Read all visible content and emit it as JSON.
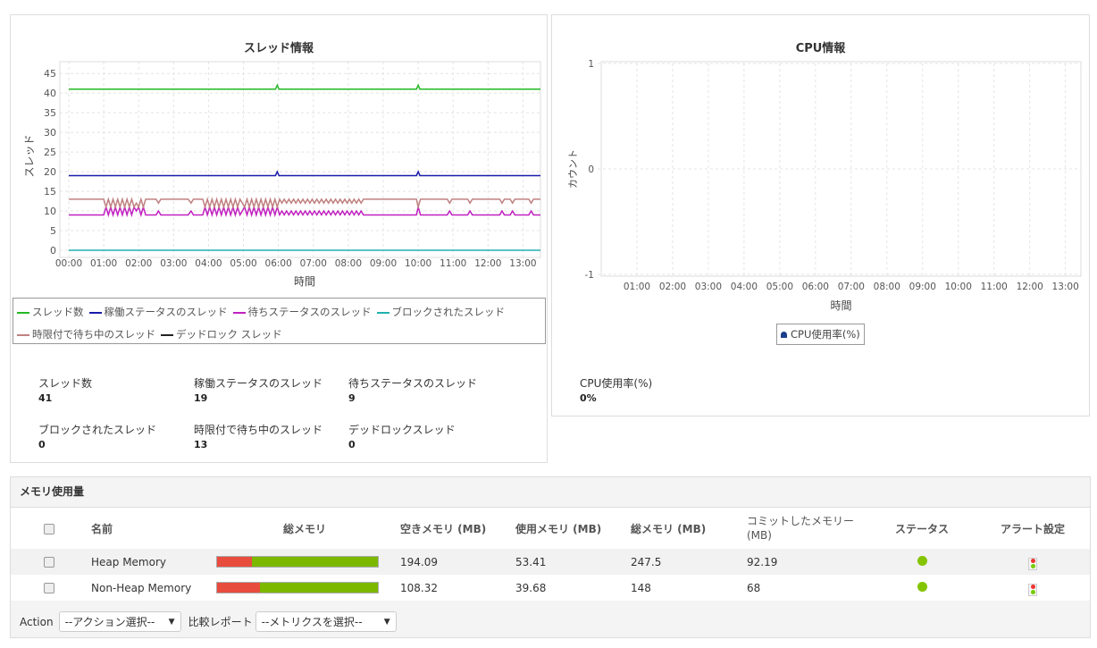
{
  "threads": {
    "title": "スレッド情報",
    "ylabel": "スレッド",
    "xlabel": "時間",
    "stats": [
      {
        "label": "スレッド数",
        "value": "41"
      },
      {
        "label": "稼働ステータスのスレッド",
        "value": "19"
      },
      {
        "label": "待ちステータスのスレッド",
        "value": "9"
      },
      {
        "label": "ブロックされたスレッド",
        "value": "0"
      },
      {
        "label": "時限付で待ち中のスレッド",
        "value": "13"
      },
      {
        "label": "デッドロックスレッド",
        "value": "0"
      }
    ]
  },
  "cpu": {
    "title": "CPU情報",
    "ylabel": "カウント",
    "xlabel": "時間",
    "legend": "CPU使用率(%)",
    "stat_label": "CPU使用率(%)",
    "stat_value": "0%"
  },
  "chart_data": [
    {
      "type": "line",
      "title": "スレッド情報",
      "xlabel": "時間",
      "ylabel": "スレッド",
      "x_unit": "minutes",
      "xlim": [
        0,
        810
      ],
      "ylim": [
        0,
        48
      ],
      "yticks": [
        0,
        5,
        10,
        15,
        20,
        25,
        30,
        35,
        40,
        45
      ],
      "xticks": [
        "00:00",
        "01:00",
        "02:00",
        "03:00",
        "04:00",
        "05:00",
        "06:00",
        "07:00",
        "08:00",
        "09:00",
        "10:00",
        "11:00",
        "12:00",
        "13:00"
      ],
      "grid": true,
      "legend": "bottom",
      "series": [
        {
          "name": "スレッド数",
          "color": "#22b822",
          "points": [
            [
              0,
              41
            ],
            [
              355,
              41
            ],
            [
              358,
              42
            ],
            [
              361,
              41
            ],
            [
              597,
              41
            ],
            [
              600,
              42
            ],
            [
              603,
              41
            ],
            [
              810,
              41
            ]
          ]
        },
        {
          "name": "稼働ステータスのスレッド",
          "color": "#1a1aaa",
          "points": [
            [
              0,
              19
            ],
            [
              355,
              19
            ],
            [
              358,
              20
            ],
            [
              361,
              19
            ],
            [
              597,
              19
            ],
            [
              600,
              20
            ],
            [
              603,
              19
            ],
            [
              810,
              19
            ]
          ]
        },
        {
          "name": "待ちステータスのスレッド",
          "color": "#c020c0",
          "points": [
            [
              0,
              9
            ],
            [
              60,
              9
            ],
            [
              64,
              11
            ],
            [
              68,
              9
            ],
            [
              72,
              11
            ],
            [
              76,
              9
            ],
            [
              80,
              11
            ],
            [
              84,
              9
            ],
            [
              88,
              11
            ],
            [
              92,
              9
            ],
            [
              96,
              11
            ],
            [
              100,
              9
            ],
            [
              104,
              11
            ],
            [
              108,
              9
            ],
            [
              112,
              11
            ],
            [
              116,
              10
            ],
            [
              120,
              11
            ],
            [
              124,
              9
            ],
            [
              128,
              11
            ],
            [
              132,
              9
            ],
            [
              150,
              9
            ],
            [
              154,
              10
            ],
            [
              158,
              9
            ],
            [
              205,
              9
            ],
            [
              210,
              10
            ],
            [
              214,
              9
            ],
            [
              230,
              9
            ],
            [
              234,
              11
            ],
            [
              238,
              9
            ],
            [
              242,
              11
            ],
            [
              246,
              9
            ],
            [
              250,
              11
            ],
            [
              254,
              9
            ],
            [
              258,
              11
            ],
            [
              262,
              9
            ],
            [
              266,
              11
            ],
            [
              270,
              9
            ],
            [
              274,
              11
            ],
            [
              278,
              9
            ],
            [
              282,
              11
            ],
            [
              286,
              9
            ],
            [
              290,
              11
            ],
            [
              294,
              9
            ],
            [
              298,
              10
            ],
            [
              302,
              11
            ],
            [
              306,
              9
            ],
            [
              310,
              11
            ],
            [
              314,
              9
            ],
            [
              318,
              11
            ],
            [
              322,
              9
            ],
            [
              326,
              11
            ],
            [
              330,
              9
            ],
            [
              334,
              11
            ],
            [
              338,
              9
            ],
            [
              342,
              11
            ],
            [
              346,
              9
            ],
            [
              350,
              11
            ],
            [
              354,
              9
            ],
            [
              358,
              11
            ],
            [
              362,
              9
            ],
            [
              366,
              10
            ],
            [
              370,
              9
            ],
            [
              374,
              10
            ],
            [
              378,
              9
            ],
            [
              382,
              10
            ],
            [
              386,
              9
            ],
            [
              390,
              10
            ],
            [
              394,
              9
            ],
            [
              398,
              10
            ],
            [
              402,
              9
            ],
            [
              406,
              10
            ],
            [
              410,
              9
            ],
            [
              414,
              10
            ],
            [
              418,
              9
            ],
            [
              422,
              10
            ],
            [
              426,
              9
            ],
            [
              430,
              10
            ],
            [
              434,
              9
            ],
            [
              438,
              10
            ],
            [
              442,
              9
            ],
            [
              446,
              10
            ],
            [
              450,
              9
            ],
            [
              454,
              10
            ],
            [
              458,
              9
            ],
            [
              462,
              10
            ],
            [
              466,
              9
            ],
            [
              470,
              10
            ],
            [
              474,
              9
            ],
            [
              478,
              10
            ],
            [
              482,
              9
            ],
            [
              486,
              10
            ],
            [
              490,
              9
            ],
            [
              494,
              10
            ],
            [
              498,
              9
            ],
            [
              502,
              10
            ],
            [
              506,
              9
            ],
            [
              520,
              9
            ],
            [
              597,
              9
            ],
            [
              600,
              11
            ],
            [
              604,
              9
            ],
            [
              650,
              9
            ],
            [
              654,
              10
            ],
            [
              658,
              9
            ],
            [
              685,
              9
            ],
            [
              689,
              10
            ],
            [
              693,
              9
            ],
            [
              740,
              9
            ],
            [
              744,
              10
            ],
            [
              748,
              9
            ],
            [
              758,
              9
            ],
            [
              762,
              10
            ],
            [
              766,
              9
            ],
            [
              790,
              9
            ],
            [
              794,
              10
            ],
            [
              798,
              9
            ],
            [
              810,
              9
            ]
          ]
        },
        {
          "name": "ブロックされたスレッド",
          "color": "#20b0b0",
          "points": [
            [
              0,
              0
            ],
            [
              810,
              0
            ]
          ]
        },
        {
          "name": "時限付で待ち中のスレッド",
          "color": "#c08080",
          "points": [
            [
              0,
              13
            ],
            [
              60,
              13
            ],
            [
              64,
              11
            ],
            [
              68,
              13
            ],
            [
              72,
              11
            ],
            [
              76,
              13
            ],
            [
              80,
              11
            ],
            [
              84,
              13
            ],
            [
              88,
              11
            ],
            [
              92,
              13
            ],
            [
              96,
              11
            ],
            [
              100,
              13
            ],
            [
              104,
              11
            ],
            [
              108,
              13
            ],
            [
              112,
              11
            ],
            [
              116,
              12
            ],
            [
              120,
              11
            ],
            [
              124,
              13
            ],
            [
              128,
              11
            ],
            [
              132,
              13
            ],
            [
              150,
              13
            ],
            [
              154,
              12
            ],
            [
              158,
              13
            ],
            [
              205,
              13
            ],
            [
              210,
              12
            ],
            [
              214,
              13
            ],
            [
              230,
              13
            ],
            [
              234,
              11
            ],
            [
              238,
              13
            ],
            [
              242,
              11
            ],
            [
              246,
              13
            ],
            [
              250,
              11
            ],
            [
              254,
              13
            ],
            [
              258,
              11
            ],
            [
              262,
              13
            ],
            [
              266,
              11
            ],
            [
              270,
              13
            ],
            [
              274,
              11
            ],
            [
              278,
              13
            ],
            [
              282,
              11
            ],
            [
              286,
              13
            ],
            [
              290,
              11
            ],
            [
              294,
              13
            ],
            [
              298,
              12
            ],
            [
              302,
              11
            ],
            [
              306,
              13
            ],
            [
              310,
              11
            ],
            [
              314,
              13
            ],
            [
              318,
              11
            ],
            [
              322,
              13
            ],
            [
              326,
              11
            ],
            [
              330,
              13
            ],
            [
              334,
              11
            ],
            [
              338,
              13
            ],
            [
              342,
              11
            ],
            [
              346,
              13
            ],
            [
              350,
              11
            ],
            [
              354,
              13
            ],
            [
              358,
              11
            ],
            [
              362,
              13
            ],
            [
              366,
              12
            ],
            [
              370,
              13
            ],
            [
              374,
              12
            ],
            [
              378,
              13
            ],
            [
              382,
              12
            ],
            [
              386,
              13
            ],
            [
              390,
              12
            ],
            [
              394,
              13
            ],
            [
              398,
              12
            ],
            [
              402,
              13
            ],
            [
              406,
              12
            ],
            [
              410,
              13
            ],
            [
              414,
              12
            ],
            [
              418,
              13
            ],
            [
              422,
              12
            ],
            [
              426,
              13
            ],
            [
              430,
              12
            ],
            [
              434,
              13
            ],
            [
              438,
              12
            ],
            [
              442,
              13
            ],
            [
              446,
              12
            ],
            [
              450,
              13
            ],
            [
              454,
              12
            ],
            [
              458,
              13
            ],
            [
              462,
              12
            ],
            [
              466,
              13
            ],
            [
              470,
              12
            ],
            [
              474,
              13
            ],
            [
              478,
              12
            ],
            [
              482,
              13
            ],
            [
              486,
              12
            ],
            [
              490,
              13
            ],
            [
              494,
              12
            ],
            [
              498,
              13
            ],
            [
              502,
              12
            ],
            [
              506,
              13
            ],
            [
              520,
              13
            ],
            [
              597,
              13
            ],
            [
              600,
              11
            ],
            [
              604,
              13
            ],
            [
              650,
              13
            ],
            [
              654,
              12
            ],
            [
              658,
              13
            ],
            [
              685,
              13
            ],
            [
              689,
              12
            ],
            [
              693,
              13
            ],
            [
              740,
              13
            ],
            [
              744,
              12
            ],
            [
              748,
              13
            ],
            [
              758,
              13
            ],
            [
              762,
              12
            ],
            [
              766,
              13
            ],
            [
              790,
              13
            ],
            [
              794,
              12
            ],
            [
              798,
              13
            ],
            [
              810,
              13
            ]
          ]
        },
        {
          "name": "デッドロック スレッド",
          "color": "#222222",
          "points": []
        }
      ]
    },
    {
      "type": "line",
      "title": "CPU情報",
      "xlabel": "時間",
      "ylabel": "カウント",
      "x_unit": "minutes",
      "xlim": [
        0,
        806
      ],
      "ylim": [
        -1,
        1
      ],
      "yticks": [
        1,
        0,
        -1
      ],
      "xticks": [
        "01:00",
        "02:00",
        "03:00",
        "04:00",
        "05:00",
        "06:00",
        "07:00",
        "08:00",
        "09:00",
        "10:00",
        "11:00",
        "12:00",
        "13:00"
      ],
      "grid": true,
      "legend": "bottom",
      "series": [
        {
          "name": "CPU使用率(%)",
          "color": "#1a3f8a",
          "points": []
        }
      ]
    }
  ],
  "memory": {
    "title": "メモリ使用量",
    "headers": {
      "name": "名前",
      "total_bar": "総メモリ",
      "free": "空きメモリ (MB)",
      "used": "使用メモリ (MB)",
      "total": "総メモリ (MB)",
      "committed": "コミットしたメモリー (MB)",
      "status": "ステータス",
      "alert": "アラート設定"
    },
    "rows": [
      {
        "name": "Heap Memory",
        "used_pct": 21.6,
        "free": "194.09",
        "used": "53.41",
        "total": "247.5",
        "committed": "92.19",
        "status_color": "#84c400"
      },
      {
        "name": "Non-Heap Memory",
        "used_pct": 26.8,
        "free": "108.32",
        "used": "39.68",
        "total": "148",
        "committed": "68",
        "status_color": "#84c400"
      }
    ],
    "action_label": "Action",
    "action_select": "--アクション選択--",
    "compare_label": "比較レポート",
    "compare_select": "--メトリクスを選択--"
  }
}
